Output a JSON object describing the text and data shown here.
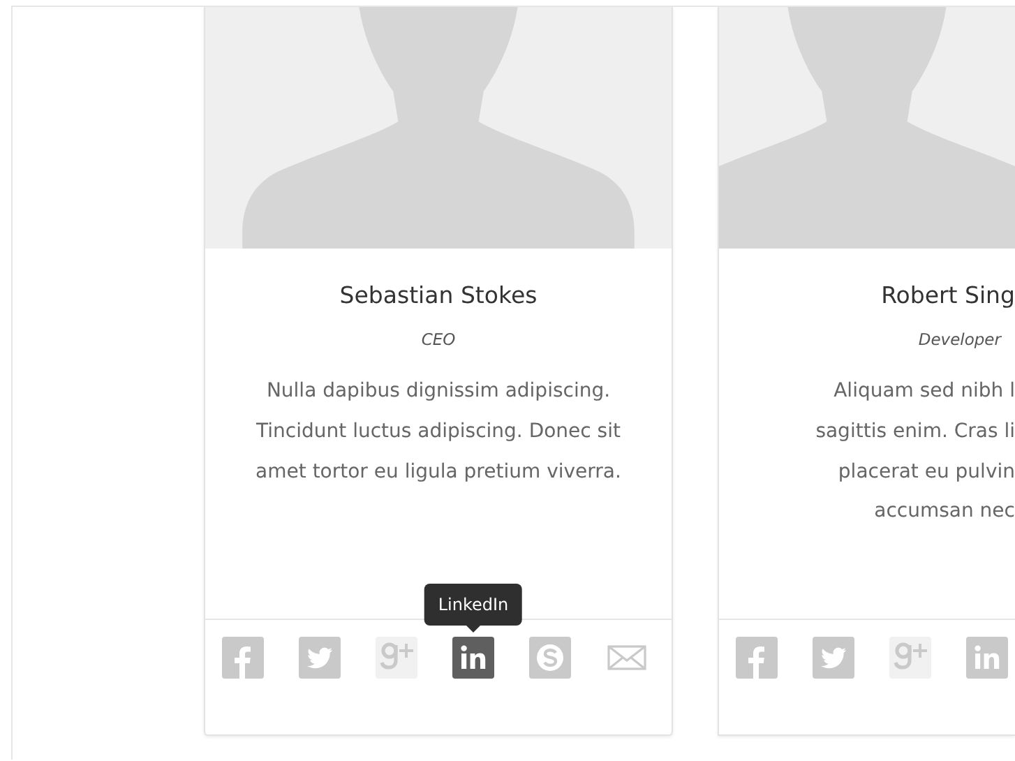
{
  "cards": [
    {
      "name": "Sebastian Stokes",
      "role": "CEO",
      "description": "Nulla dapibus dignissim adipiscing. Tincidunt luctus adipiscing. Donec sit amet tortor eu ligula pretium viverra.",
      "cut": false,
      "social": [
        {
          "kind": "facebook",
          "highlighted": false
        },
        {
          "kind": "twitter",
          "highlighted": false
        },
        {
          "kind": "google-plus",
          "highlighted": false
        },
        {
          "kind": "linkedin",
          "highlighted": true,
          "tooltip": "LinkedIn"
        },
        {
          "kind": "skype",
          "highlighted": false
        },
        {
          "kind": "email",
          "highlighted": false
        }
      ]
    },
    {
      "name": "Robert Sing",
      "role": "Developer",
      "description": "Aliquam sed nibh l\nsagittis enim. Cras li\nplacerat eu pulvin\naccumsan nec",
      "cut": true,
      "social": [
        {
          "kind": "facebook",
          "highlighted": false
        },
        {
          "kind": "twitter",
          "highlighted": false
        },
        {
          "kind": "google-plus",
          "highlighted": false
        },
        {
          "kind": "linkedin",
          "highlighted": false
        }
      ]
    }
  ]
}
